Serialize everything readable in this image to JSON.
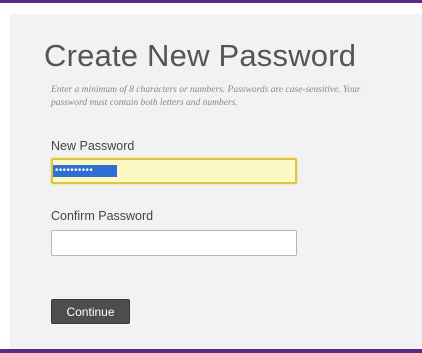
{
  "heading": "Create New Password",
  "instructions": "Enter a minimum of 8 characters or numbers. Passwords are case-sensitive. Your password must contain both letters and numbers.",
  "new_password": {
    "label": "New Password",
    "masked_value": "••••••••••",
    "state": "focused, text selected"
  },
  "confirm_password": {
    "label": "Confirm Password",
    "value": ""
  },
  "continue_button": {
    "label": "Continue"
  },
  "colors": {
    "accent_border": "#5b2a86",
    "focused_field_bg": "#fdf9c4",
    "focused_field_border": "#e0c341",
    "selection": "#2f6ed3",
    "button_bg": "#4d4d4d"
  }
}
